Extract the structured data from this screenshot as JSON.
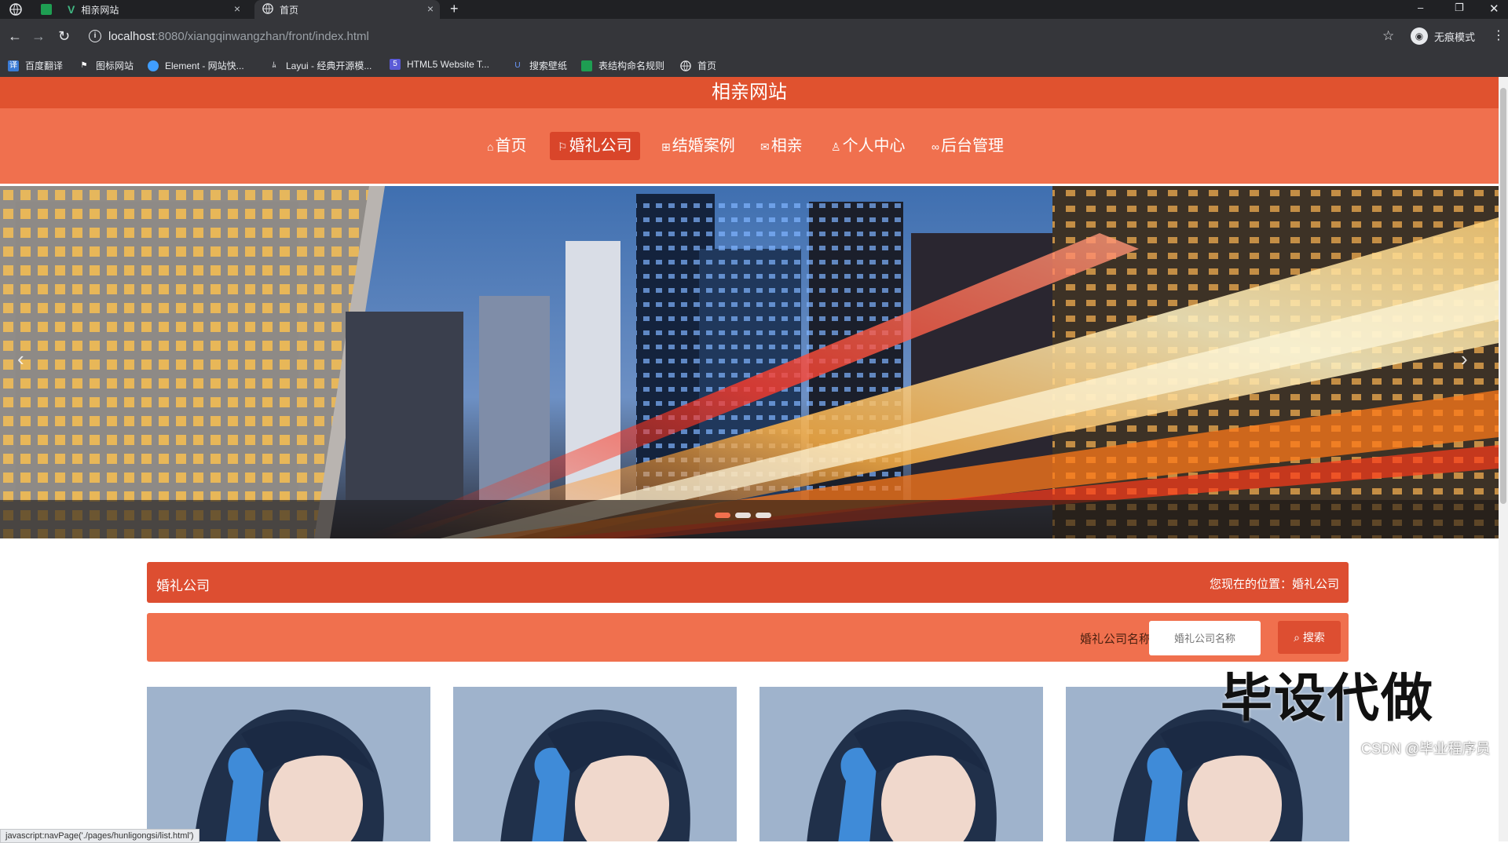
{
  "browser": {
    "tabs": [
      {
        "title": "相亲网站",
        "active": false
      },
      {
        "title": "首页",
        "active": true
      }
    ],
    "url_host": "localhost",
    "url_path": ":8080/xiangqinwangzhan/front/index.html",
    "incognito_label": "无痕模式",
    "bookmarks": [
      {
        "label": "百度翻译",
        "color": "#3a7bd5"
      },
      {
        "label": "图标网站",
        "color": "#ffffff"
      },
      {
        "label": "Element - 网站快...",
        "color": "#409eff"
      },
      {
        "label": "Layui - 经典开源模...",
        "color": "#5fb878"
      },
      {
        "label": "HTML5 Website T...",
        "color": "#5a5ad6"
      },
      {
        "label": "搜索壁纸",
        "color": "#4a7bd6"
      },
      {
        "label": "表结构命名规则",
        "color": "#1e9e52"
      },
      {
        "label": "首页",
        "color": "#bdc1c6"
      }
    ],
    "status_url": "javascript:navPage('./pages/hunligongsi/list.html')"
  },
  "site": {
    "title": "相亲网站",
    "nav": [
      {
        "label": "首页",
        "icon": "home-icon",
        "glyph": "⌂",
        "active": false
      },
      {
        "label": "婚礼公司",
        "icon": "flag-icon",
        "glyph": "⚐",
        "active": true
      },
      {
        "label": "结婚案例",
        "icon": "gift-icon",
        "glyph": "⊞",
        "active": false
      },
      {
        "label": "相亲",
        "icon": "mail-icon",
        "glyph": "✉",
        "active": false
      },
      {
        "label": "个人中心",
        "icon": "user-icon",
        "glyph": "ꝏ",
        "active": false
      },
      {
        "label": "后台管理",
        "icon": "link-icon",
        "glyph": "🔗",
        "active": false
      }
    ],
    "banner": {
      "slides": 3,
      "current": 1
    },
    "section_title": "婚礼公司",
    "breadcrumb": "您现在的位置：婚礼公司",
    "search": {
      "label": "婚礼公司名称",
      "placeholder": "婚礼公司名称",
      "button": "搜索"
    },
    "cards": 4
  },
  "overlay": {
    "watermark": "毕设代做",
    "credit": "CSDN @毕业程序员"
  },
  "colors": {
    "title_bar": "#e0522f",
    "nav_bar": "#f0704e",
    "nav_active": "#d9452a"
  }
}
